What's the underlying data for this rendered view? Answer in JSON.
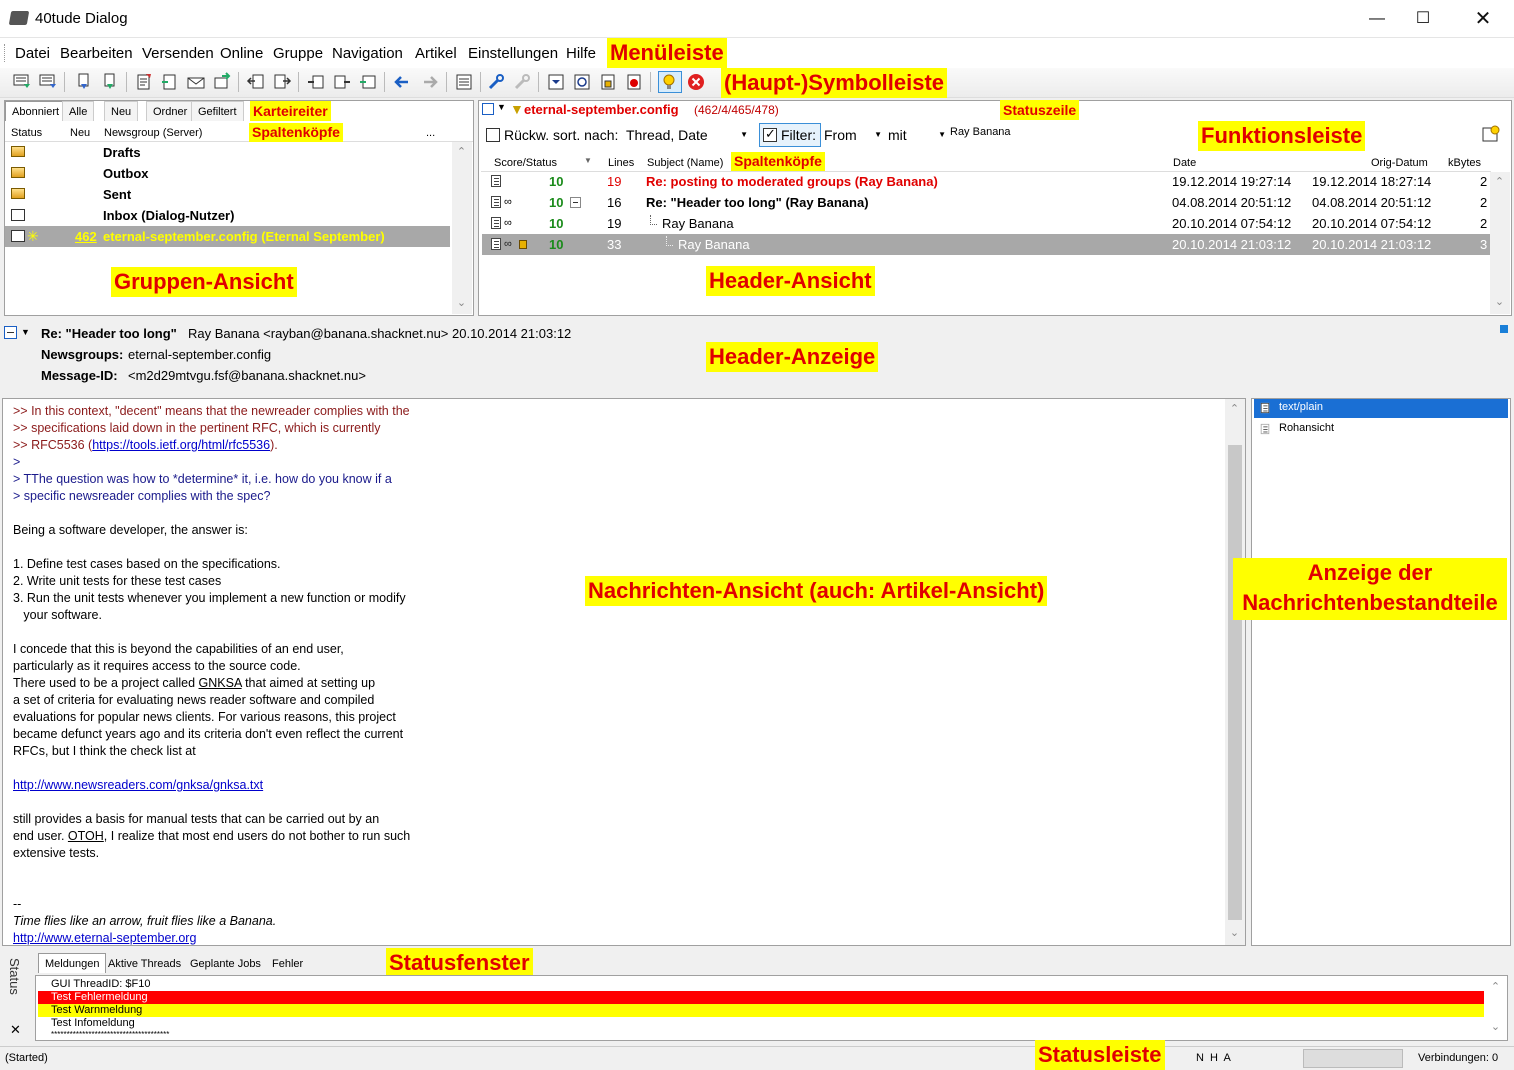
{
  "window": {
    "title": "40tude Dialog"
  },
  "menu": [
    "Datei",
    "Bearbeiten",
    "Versenden",
    "Online",
    "Gruppe",
    "Navigation",
    "Artikel",
    "Einstellungen",
    "Hilfe"
  ],
  "annotations": {
    "menubar": "Menüleiste",
    "toolbar": "(Haupt-)Symbolleiste",
    "tabs": "Karteireiter",
    "colheads_groups": "Spaltenköpfe",
    "statusline": "Statuszeile",
    "funcbar": "Funktionsleiste",
    "colheads_headers": "Spaltenköpfe",
    "groups_view": "Gruppen-Ansicht",
    "header_view": "Header-Ansicht",
    "header_display": "Header-Anzeige",
    "message_view": "Nachrichten-Ansicht (auch: Artikel-Ansicht)",
    "parts_view_1": "Anzeige der",
    "parts_view_2": "Nachrichtenbestandteile",
    "status_window": "Statusfenster",
    "statusbar": "Statusleiste"
  },
  "groups": {
    "tabs": [
      "Abonniert",
      "Alle",
      "Neu",
      "Ordner",
      "Gefiltert"
    ],
    "columns": [
      "Status",
      "Neu",
      "Newsgroup (Server)",
      "..."
    ],
    "rows": [
      {
        "count": "",
        "name": "Drafts"
      },
      {
        "count": "",
        "name": "Outbox"
      },
      {
        "count": "",
        "name": "Sent"
      },
      {
        "count": "",
        "name": "Inbox (Dialog-Nutzer)"
      },
      {
        "count": "462",
        "name": "eternal-september.config (Eternal September)"
      }
    ]
  },
  "headers": {
    "group_name": "eternal-september.config",
    "group_counts": "(462/4/465/478)",
    "funcbar": {
      "sort_label": "Rückw. sort. nach:",
      "sort_value": "Thread, Date",
      "filter_label": "Filter:",
      "filter_field": "From",
      "filter_op": "mit",
      "filter_value": "Ray Banana"
    },
    "columns": [
      "Score/Status",
      "Lines",
      "Subject (Name)",
      "Date",
      "Orig-Datum",
      "kBytes"
    ],
    "rows": [
      {
        "score": "10",
        "lines": "19",
        "subject": "Re: posting to moderated groups (Ray Banana)",
        "date": "19.12.2014 19:27:14",
        "orig": "19.12.2014 18:27:14",
        "kb": "2"
      },
      {
        "score": "10",
        "lines": "16",
        "subject": "Re: \"Header too long\" (Ray Banana)",
        "date": "04.08.2014 20:51:12",
        "orig": "04.08.2014 20:51:12",
        "kb": "2"
      },
      {
        "score": "10",
        "lines": "19",
        "subject": "Ray Banana",
        "date": "20.10.2014 07:54:12",
        "orig": "20.10.2014 07:54:12",
        "kb": "2"
      },
      {
        "score": "10",
        "lines": "33",
        "subject": "Ray Banana",
        "date": "20.10.2014 21:03:12",
        "orig": "20.10.2014 21:03:12",
        "kb": "3"
      }
    ]
  },
  "article": {
    "subject": "Re: \"Header too long\"",
    "from": "Ray Banana <rayban@banana.shacknet.nu> 20.10.2014 21:03:12",
    "newsgroups_label": "Newsgroups:",
    "newsgroups": "eternal-september.config",
    "msgid_label": "Message-ID:",
    "msgid": "<m2d29mtvgu.fsf@banana.shacknet.nu>",
    "body": {
      "q2_1": ">> In this context, \"decent\" means that the newreader complies with the",
      "q2_2": ">> specifications laid down in the pertinent RFC, which is currently",
      "q2_3a": ">> RFC5536 (",
      "q2_3link": "https://tools.ietf.org/html/rfc5536",
      "q2_3b": ").",
      "q1_0": ">",
      "q1_1": "> TThe question was how to *determine* it, i.e. how do you know if a",
      "q1_2": "> specific newsreader complies with the spec?",
      "p1": "Being a software developer, the answer is:",
      "l1": "1. Define test cases based on the specifications.",
      "l2": "2. Write unit tests for these test cases",
      "l3": "3. Run the unit tests whenever you implement a new function or modify",
      "l3b": "   your software.",
      "p2_1": "I concede that this is beyond the capabilities of an end user,",
      "p2_2": "particularly as it requires access to the source code.",
      "p2_3a": "There used to be a project called ",
      "p2_3link": "GNKSA",
      "p2_3b": " that aimed at setting up",
      "p2_4": "a set of criteria for evaluating news reader software and compiled",
      "p2_5": "evaluations for popular news clients. For various reasons, this project",
      "p2_6": "became defunct years ago and its criteria don't even reflect the current",
      "p2_7": "RFCs, but I think the check list at",
      "url1": "http://www.newsreaders.com/gnksa/gnksa.txt",
      "p3_1": "still provides a basis for manual tests that can be carried out by an",
      "p3_2a": "end user. ",
      "p3_2link": "OTOH",
      "p3_2b": ", I realize that most end users do not bother to run such",
      "p3_3": "extensive tests.",
      "sigsep": "--",
      "sig": "Time flies like an arrow, fruit flies like a Banana.",
      "sigurl": "http://www.eternal-september.org"
    }
  },
  "parts": [
    "text/plain",
    "Rohansicht"
  ],
  "status": {
    "side_label": "Status",
    "tabs": [
      "Meldungen",
      "Aktive Threads",
      "Geplante Jobs",
      "Fehler"
    ],
    "lines": [
      "GUI ThreadID: $F10",
      "Test Fehlermeldung",
      "Test Warnmeldung",
      "Test Infomeldung",
      "**************************************"
    ]
  },
  "statusbar": {
    "left": "(Started)",
    "nha": "N  H  A",
    "connections": "Verbindungen: 0"
  }
}
